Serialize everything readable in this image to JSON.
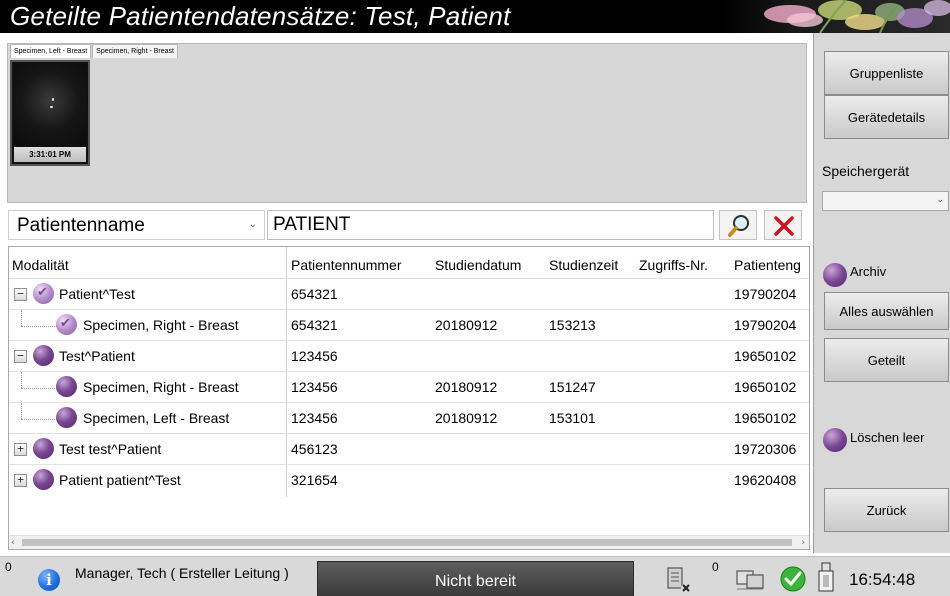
{
  "window": {
    "title": "Geteilte Patientendatensätze: Test, Patient"
  },
  "thumbnails": {
    "tabs": [
      "Specimen, Left - Breast",
      "Specimen, Right - Breast"
    ],
    "items": [
      {
        "time": "3:31:01 PM"
      }
    ]
  },
  "search": {
    "field": "Patientenname",
    "query": "PATIENT"
  },
  "table": {
    "columns": [
      "Modalität",
      "Patientennummer",
      "Studiendatum",
      "Studienzeit",
      "Zugriffs-Nr.",
      "Patienteng"
    ],
    "rows": [
      {
        "name": "Patient^Test",
        "level": 0,
        "expander": "−",
        "checked": true,
        "id": "654321",
        "date": "",
        "time": "",
        "access": "",
        "birth": "19790204"
      },
      {
        "name": "Specimen, Right - Breast",
        "level": 1,
        "expander": "",
        "checked": true,
        "id": "654321",
        "date": "20180912",
        "time": "153213",
        "access": "",
        "birth": "19790204"
      },
      {
        "name": "Test^Patient",
        "level": 0,
        "expander": "−",
        "checked": false,
        "id": "123456",
        "date": "",
        "time": "",
        "access": "",
        "birth": "19650102"
      },
      {
        "name": "Specimen, Right - Breast",
        "level": 1,
        "expander": "",
        "checked": false,
        "id": "123456",
        "date": "20180912",
        "time": "151247",
        "access": "",
        "birth": "19650102"
      },
      {
        "name": "Specimen, Left - Breast",
        "level": 1,
        "expander": "",
        "checked": false,
        "id": "123456",
        "date": "20180912",
        "time": "153101",
        "access": "",
        "birth": "19650102"
      },
      {
        "name": "Test test^Patient",
        "level": 0,
        "expander": "+",
        "checked": false,
        "id": "456123",
        "date": "",
        "time": "",
        "access": "",
        "birth": "19720306"
      },
      {
        "name": "Patient patient^Test",
        "level": 0,
        "expander": "+",
        "checked": false,
        "id": "321654",
        "date": "",
        "time": "",
        "access": "",
        "birth": "19620408"
      }
    ]
  },
  "sidebar": {
    "group_list": "Gruppenliste",
    "device_details": "Gerätedetails",
    "storage_label": "Speichergerät",
    "storage_value": "",
    "archive": "Archiv",
    "select_all": "Alles auswählen",
    "shared": "Geteilt",
    "delete_empty": "Löschen leer",
    "back": "Zurück"
  },
  "status": {
    "count_left": "0",
    "user": "Manager, Tech ( Ersteller Leitung )",
    "state": "Nicht bereit",
    "count_right": "0",
    "clock": "16:54:48"
  },
  "icons": {
    "info": "info-icon",
    "search": "magnifier-icon",
    "clear": "red-x-icon",
    "print_queue": "print-queue-icon",
    "network": "network-icon",
    "ok": "green-check-icon",
    "usb": "usb-icon"
  },
  "colors": {
    "title_bg": "#000000",
    "orb_purple": "#7a4892",
    "clear_red": "#d0121b",
    "status_dark": "#3a3a3a"
  }
}
